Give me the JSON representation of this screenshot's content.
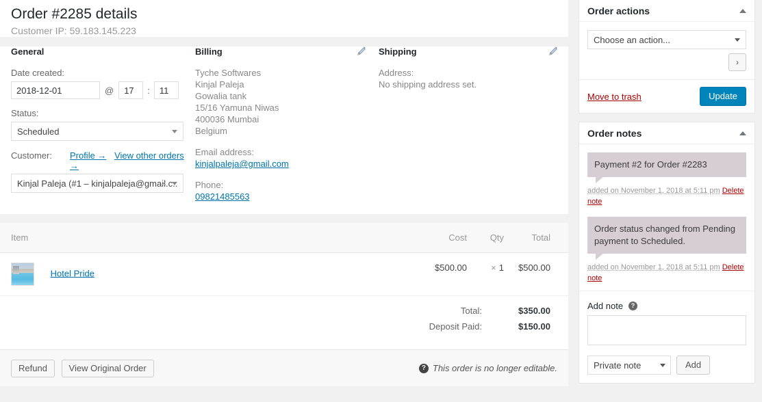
{
  "order": {
    "title": "Order #2285 details",
    "customer_ip_label": "Customer IP: 59.183.145.223"
  },
  "general": {
    "heading": "General",
    "date_label": "Date created:",
    "date_value": "2018-12-01",
    "at_char": "@",
    "hour_value": "17",
    "colon_char": ":",
    "minute_value": "11",
    "status_label": "Status:",
    "status_value": "Scheduled",
    "customer_label": "Customer:",
    "profile_link": "Profile →",
    "other_orders_link": "View other orders →",
    "customer_value": "Kinjal Paleja (#1 – kinjalpaleja@gmail.c...",
    "clear_glyph": "×"
  },
  "billing": {
    "heading": "Billing",
    "address_lines": [
      "Tyche Softwares",
      "Kinjal Paleja",
      "Gowalia tank",
      "15/16 Yamuna Niwas",
      "400036 Mumbai",
      "Belgium"
    ],
    "email_label": "Email address:",
    "email_value": "kinjalpaleja@gmail.com",
    "phone_label": "Phone:",
    "phone_value": "09821485563"
  },
  "shipping": {
    "heading": "Shipping",
    "address_label": "Address:",
    "address_value": "No shipping address set."
  },
  "items": {
    "columns": {
      "item": "Item",
      "cost": "Cost",
      "qty": "Qty",
      "total": "Total"
    },
    "rows": [
      {
        "name": "Hotel Pride",
        "cost": "$500.00",
        "qty_prefix": "×",
        "qty": "1",
        "total": "$500.00"
      }
    ],
    "totals": [
      {
        "label": "Total:",
        "value": "$350.00"
      },
      {
        "label": "Deposit Paid:",
        "value": "$150.00"
      }
    ],
    "footer": {
      "refund_label": "Refund",
      "view_original_label": "View Original Order",
      "not_editable_text": "This order is no longer editable.",
      "help_glyph": "?"
    }
  },
  "order_actions": {
    "title": "Order actions",
    "action_select_value": "Choose an action...",
    "next_glyph": "›",
    "trash_label": "Move to trash",
    "update_label": "Update"
  },
  "order_notes": {
    "title": "Order notes",
    "notes": [
      {
        "text": "Payment #2 for Order #2283",
        "added": "added on November 1, 2018 at 5:11 pm",
        "delete_label": "Delete note"
      },
      {
        "text": "Order status changed from Pending payment to Scheduled.",
        "added": "added on November 1, 2018 at 5:11 pm",
        "delete_label": "Delete note"
      }
    ],
    "add_note_label": "Add note",
    "help_glyph": "?",
    "note_textarea_value": "",
    "note_type_value": "Private note",
    "add_button_label": "Add"
  },
  "colors": {
    "accent_blue": "#0085ba",
    "link_blue": "#0073aa",
    "note_bubble": "#d7cdd4",
    "danger_red": "#a00",
    "page_bg": "#f1f1f1"
  }
}
